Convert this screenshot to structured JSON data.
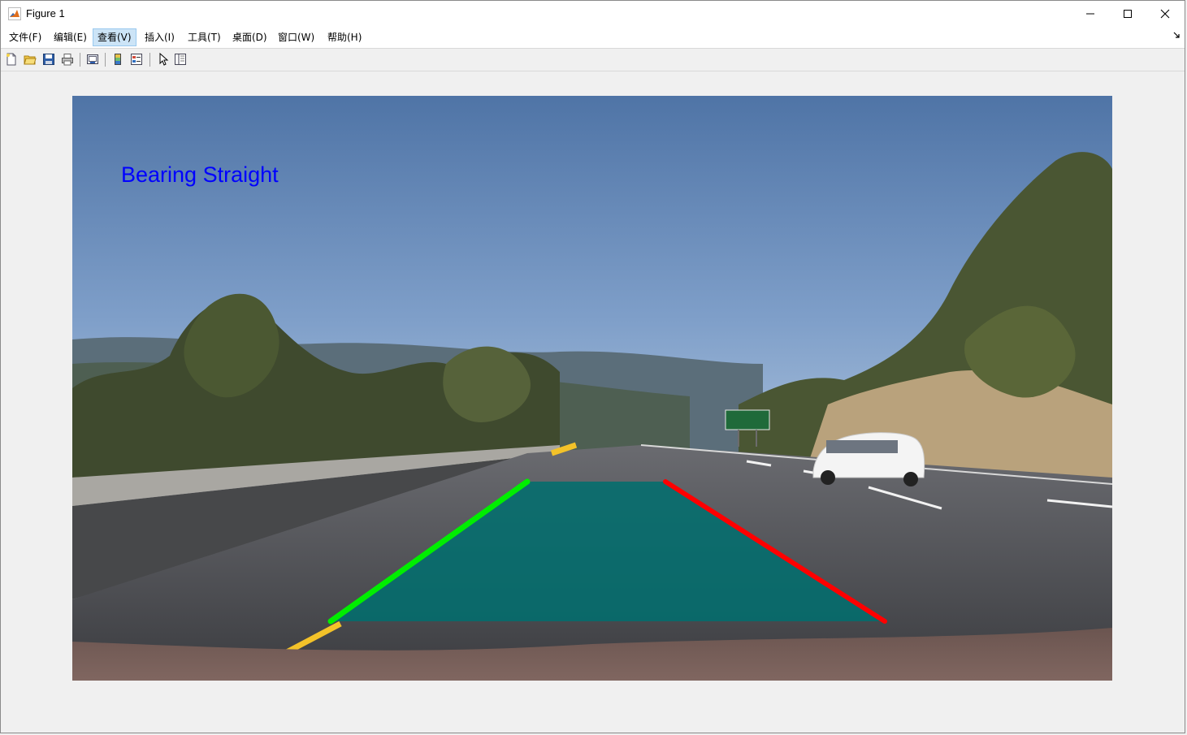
{
  "window": {
    "title": "Figure 1",
    "icon": "matlab-icon",
    "controls": [
      "minimize-icon",
      "maximize-icon",
      "close-icon"
    ]
  },
  "menu": {
    "items": [
      {
        "label": "文件(F)"
      },
      {
        "label": "编辑(E)"
      },
      {
        "label": "查看(V)"
      },
      {
        "label": "插入(I)"
      },
      {
        "label": "工具(T)"
      },
      {
        "label": "桌面(D)"
      },
      {
        "label": "窗口(W)"
      },
      {
        "label": "帮助(H)"
      }
    ],
    "active_index": 2,
    "corner_icon": "dock-arrow-icon"
  },
  "toolbar": {
    "icons": [
      "new-figure-icon",
      "open-file-icon",
      "save-icon",
      "print-icon",
      "link-plot-icon",
      "colorbar-icon",
      "legend-icon",
      "pointer-icon",
      "property-inspector-icon"
    ]
  },
  "figure": {
    "overlay_text": "Bearing Straight",
    "overlay_color": "#0000ff",
    "lane_colors": {
      "left": "#00ee00",
      "right": "#ff0000",
      "fill": "#006e6e"
    }
  }
}
